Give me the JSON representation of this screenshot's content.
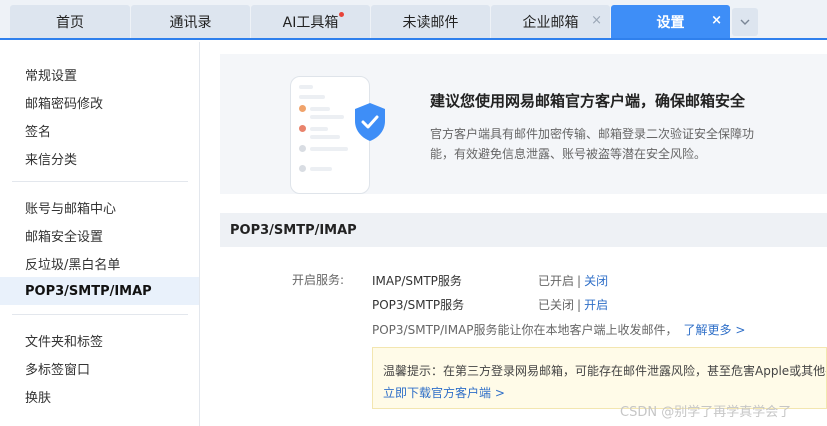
{
  "tabs": [
    {
      "label": "首页"
    },
    {
      "label": "通讯录"
    },
    {
      "label": "AI工具箱",
      "has_dot": true
    },
    {
      "label": "未读邮件"
    },
    {
      "label": "企业邮箱",
      "close": "×"
    },
    {
      "label": "设置",
      "close": "×",
      "active": true
    }
  ],
  "tab_more_icon": "chevron-down-icon",
  "sidebar": {
    "groups": [
      [
        "常规设置",
        "邮箱密码修改",
        "签名",
        "来信分类"
      ],
      [
        "账号与邮箱中心",
        "邮箱安全设置",
        "反垃圾/黑白名单",
        "POP3/SMTP/IMAP"
      ],
      [
        "文件夹和标签",
        "多标签窗口",
        "换肤"
      ]
    ],
    "active": "POP3/SMTP/IMAP"
  },
  "banner": {
    "title": "建议您使用网易邮箱官方客户端，确保邮箱安全",
    "desc": "官方客户端具有邮件加密传输、邮箱登录二次验证安全保障功能，有效避免信息泄露、账号被盗等潜在安全风险。",
    "icon": "shield-check-icon"
  },
  "section": {
    "title": "POP3/SMTP/IMAP",
    "label": "开启服务:",
    "services": [
      {
        "name": "IMAP/SMTP服务",
        "status": "已开启",
        "sep": "|",
        "action": "关闭"
      },
      {
        "name": "POP3/SMTP服务",
        "status": "已关闭",
        "sep": "|",
        "action": "开启"
      }
    ],
    "note": "POP3/SMTP/IMAP服务能让你在本地客户端上收发邮件，",
    "note_link": "了解更多 >"
  },
  "tip": {
    "text": "温馨提示：在第三方登录网易邮箱，可能存在邮件泄露风险，甚至危害Apple或其他平台账户安全",
    "link": "立即下载官方客户端 >"
  },
  "watermark": "CSDN @别学了再学真学会了",
  "colors": {
    "accent": "#3e8ef7",
    "link": "#2f6fc8",
    "active_bg": "#e9f1fb"
  }
}
